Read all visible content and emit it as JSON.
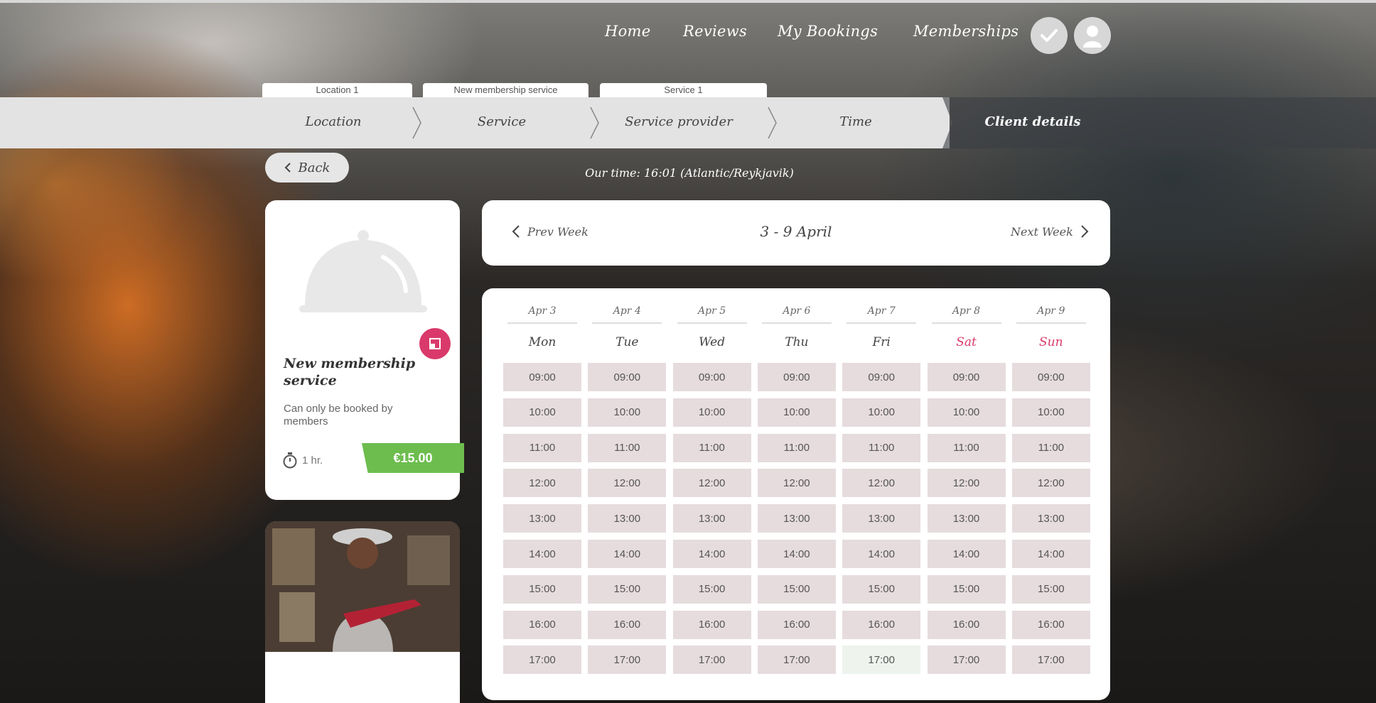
{
  "nav": {
    "links": [
      "Home",
      "Reviews",
      "My Bookings",
      "Memberships"
    ],
    "icons": [
      "check-icon",
      "user-icon"
    ]
  },
  "breadcrumbs": [
    "Location 1",
    "New membership service",
    "Service 1"
  ],
  "steps": [
    "Location",
    "Service",
    "Service provider",
    "Time",
    "Client details"
  ],
  "back_label": "Back",
  "our_time": "Our time: 16:01 (Atlantic/Reykjavik)",
  "service": {
    "title": "New membership service",
    "description": "Can only be booked by members",
    "duration": "1 hr.",
    "price": "€15.00",
    "price_color": "#6cbd4e",
    "badge_color": "#d93a6b"
  },
  "week": {
    "prev_label": "Prev Week",
    "range": "3 - 9 April",
    "next_label": "Next Week"
  },
  "calendar": {
    "days": [
      {
        "date": "Apr 3",
        "day": "Mon",
        "weekend": false
      },
      {
        "date": "Apr 4",
        "day": "Tue",
        "weekend": false
      },
      {
        "date": "Apr 5",
        "day": "Wed",
        "weekend": false
      },
      {
        "date": "Apr 6",
        "day": "Thu",
        "weekend": false
      },
      {
        "date": "Apr 7",
        "day": "Fri",
        "weekend": false
      },
      {
        "date": "Apr 8",
        "day": "Sat",
        "weekend": true
      },
      {
        "date": "Apr 9",
        "day": "Sun",
        "weekend": true
      }
    ],
    "times": [
      "09:00",
      "10:00",
      "11:00",
      "12:00",
      "13:00",
      "14:00",
      "15:00",
      "16:00",
      "17:00"
    ],
    "weekend_color": "#d93a6b"
  }
}
